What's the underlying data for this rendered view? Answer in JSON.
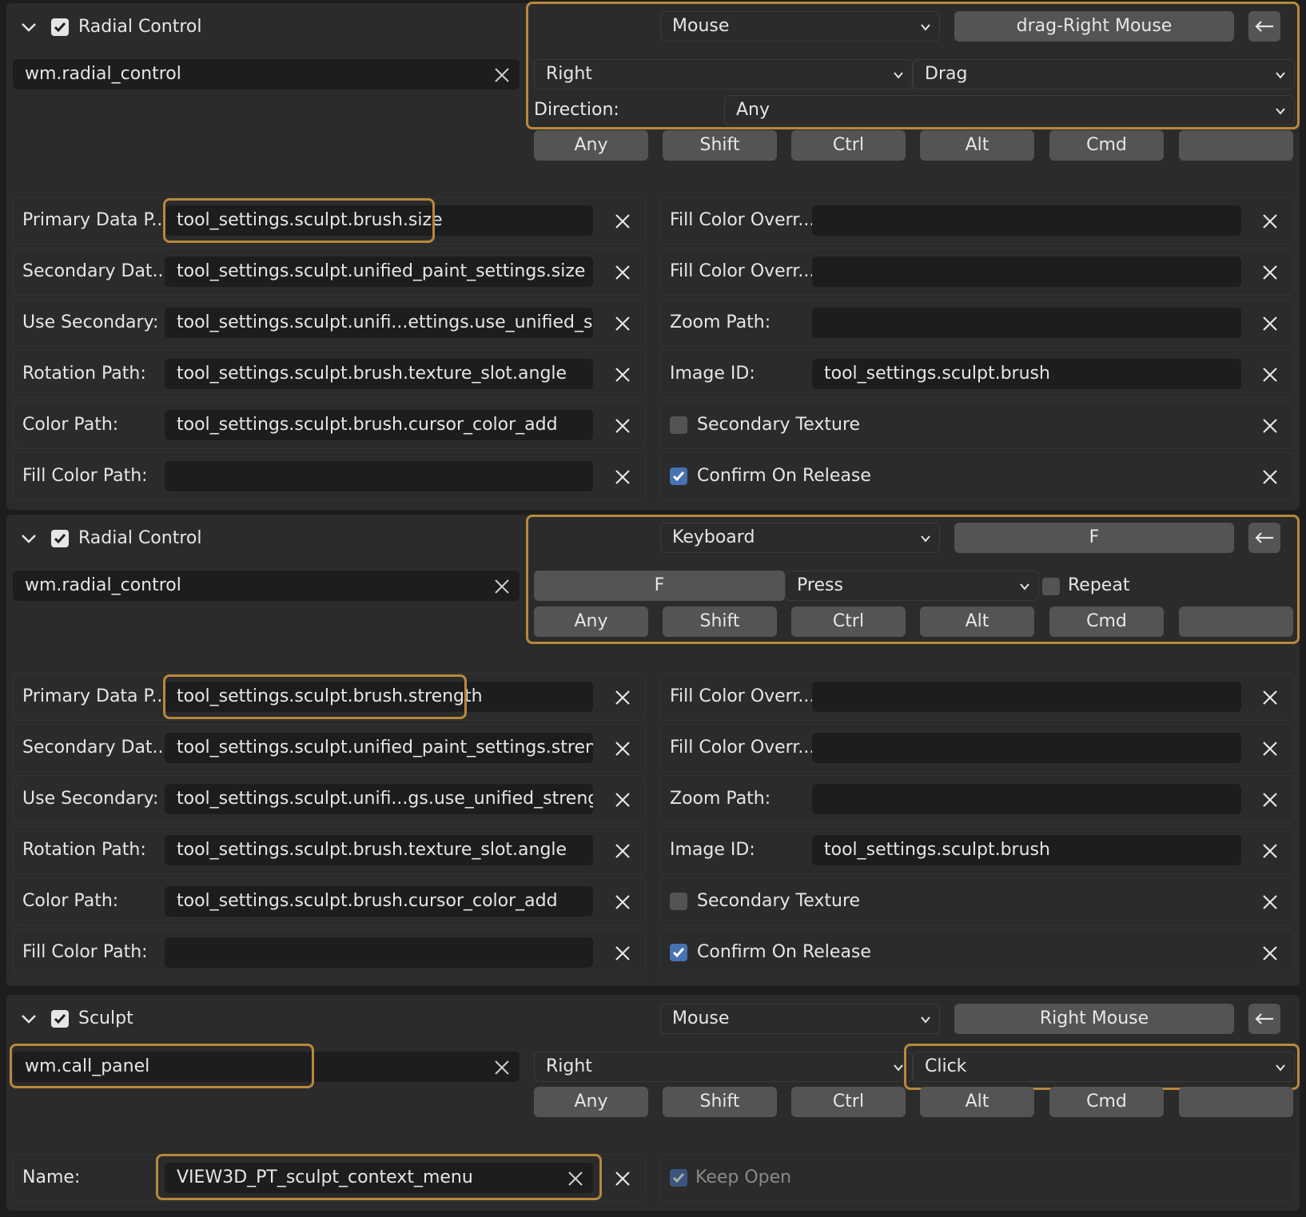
{
  "icons": {
    "expand": "chevron-down-icon",
    "clear": "close-x-icon",
    "back": "arrow-left-icon",
    "check": "checkmark-icon"
  },
  "colors": {
    "highlight": "#b8883c",
    "checkbox_blue": "#4772b3",
    "panel_bg": "#2b2b2b",
    "field_bg": "#1d1d1d"
  },
  "km1": {
    "title": "Radial Control",
    "operator": "wm.radial_control",
    "map_type": "Mouse",
    "event": "drag-Right Mouse",
    "type": "Right",
    "value": "Drag",
    "direction_label": "Direction:",
    "direction": "Any",
    "mods": [
      "Any",
      "Shift",
      "Ctrl",
      "Alt",
      "Cmd",
      ""
    ],
    "left": [
      {
        "label": "Primary Data P...",
        "value": "tool_settings.sculpt.brush.size"
      },
      {
        "label": "Secondary Dat...",
        "value": "tool_settings.sculpt.unified_paint_settings.size"
      },
      {
        "label": "Use Secondary:",
        "value": "tool_settings.sculpt.unifi...ettings.use_unified_size"
      },
      {
        "label": "Rotation Path:",
        "value": "tool_settings.sculpt.brush.texture_slot.angle"
      },
      {
        "label": "Color Path:",
        "value": "tool_settings.sculpt.brush.cursor_color_add"
      },
      {
        "label": "Fill Color Path:",
        "value": ""
      }
    ],
    "right": [
      {
        "label": "Fill Color Overr...",
        "value": ""
      },
      {
        "label": "Fill Color Overr...",
        "value": ""
      },
      {
        "label": "Zoom Path:",
        "value": ""
      },
      {
        "label": "Image ID:",
        "value": "tool_settings.sculpt.brush"
      }
    ],
    "secondary_texture": "Secondary Texture",
    "confirm_on_release": "Confirm On Release"
  },
  "km2": {
    "title": "Radial Control",
    "operator": "wm.radial_control",
    "map_type": "Keyboard",
    "event": "F",
    "key": "F",
    "value": "Press",
    "repeat": "Repeat",
    "mods": [
      "Any",
      "Shift",
      "Ctrl",
      "Alt",
      "Cmd",
      ""
    ],
    "left": [
      {
        "label": "Primary Data P...",
        "value": "tool_settings.sculpt.brush.strength"
      },
      {
        "label": "Secondary Dat...",
        "value": "tool_settings.sculpt.unified_paint_settings.strength"
      },
      {
        "label": "Use Secondary:",
        "value": "tool_settings.sculpt.unifi...gs.use_unified_strength"
      },
      {
        "label": "Rotation Path:",
        "value": "tool_settings.sculpt.brush.texture_slot.angle"
      },
      {
        "label": "Color Path:",
        "value": "tool_settings.sculpt.brush.cursor_color_add"
      },
      {
        "label": "Fill Color Path:",
        "value": ""
      }
    ],
    "right": [
      {
        "label": "Fill Color Overr...",
        "value": ""
      },
      {
        "label": "Fill Color Overr...",
        "value": ""
      },
      {
        "label": "Zoom Path:",
        "value": ""
      },
      {
        "label": "Image ID:",
        "value": "tool_settings.sculpt.brush"
      }
    ],
    "secondary_texture": "Secondary Texture",
    "confirm_on_release": "Confirm On Release"
  },
  "km3": {
    "title": "Sculpt",
    "operator": "wm.call_panel",
    "map_type": "Mouse",
    "event": "Right Mouse",
    "type": "Right",
    "value": "Click",
    "mods": [
      "Any",
      "Shift",
      "Ctrl",
      "Alt",
      "Cmd",
      ""
    ],
    "name_label": "Name:",
    "name_value": "VIEW3D_PT_sculpt_context_menu",
    "keep_open": "Keep Open"
  }
}
